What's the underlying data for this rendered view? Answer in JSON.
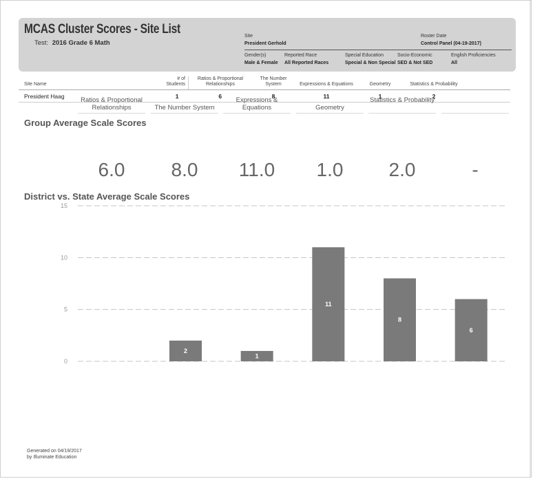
{
  "report": {
    "title": "MCAS Cluster Scores - Site List",
    "test_label": "Test:",
    "test_value": "2016 Grade 6 Math"
  },
  "filters": {
    "site_label": "Site",
    "site_value": "President Gerhold",
    "roster_label": "Roster Date",
    "roster_value": "Control Panel (04-19-2017)",
    "gender_label": "Gender(s)",
    "gender_value": "Male & Female",
    "race_label": "Reported Race",
    "race_value": "All Reported Races",
    "sped_label": "Special Education",
    "sped_value": "Special & Non Special",
    "ses_label": "Socio-Economic",
    "ses_value": "SED & Not SED",
    "ell_label": "English Proficiencies",
    "ell_value": "All"
  },
  "site_table": {
    "headers": {
      "site_name": "Site Name",
      "students_line1": "# of",
      "students_line2": "Students",
      "ratios_line1": "Ratios & Proportional",
      "ratios_line2": "Relationships",
      "number_system": "The Number System",
      "expressions": "Expressions & Equations",
      "geometry": "Geometry",
      "statistics": "Statistics & Probability"
    },
    "rows": [
      {
        "site": "President Haag",
        "students": "1",
        "ratios": "6",
        "number_system": "8",
        "expressions": "11",
        "geometry": "1",
        "statistics": "2"
      }
    ]
  },
  "group_average": {
    "title": "Group Average Scale Scores",
    "cells": [
      {
        "label": "Ratios & Proportional Relationships",
        "value": "6.0"
      },
      {
        "label": "The Number System",
        "value": "8.0"
      },
      {
        "label": "Expressions & Equations",
        "value": "11.0"
      },
      {
        "label": "Geometry",
        "value": "1.0"
      },
      {
        "label": "Statistics & Probability",
        "value": "2.0"
      },
      {
        "label": "",
        "value": "-"
      }
    ]
  },
  "district_state": {
    "title": "District vs. State Average Scale Scores"
  },
  "chart_data": {
    "type": "bar",
    "title": "District vs. State Average Scale Scores",
    "ylim": [
      0,
      15
    ],
    "yticks": [
      0,
      5,
      10,
      15
    ],
    "grid": true,
    "values": [
      0,
      2,
      1,
      11,
      8,
      6
    ],
    "data_labels": [
      "",
      "2",
      "1",
      "11",
      "8",
      "6"
    ],
    "bar_color": "#7a7a7a"
  },
  "footer": {
    "line1": "Generated on 04/19/2017",
    "line2": "by Illuminate Education"
  }
}
